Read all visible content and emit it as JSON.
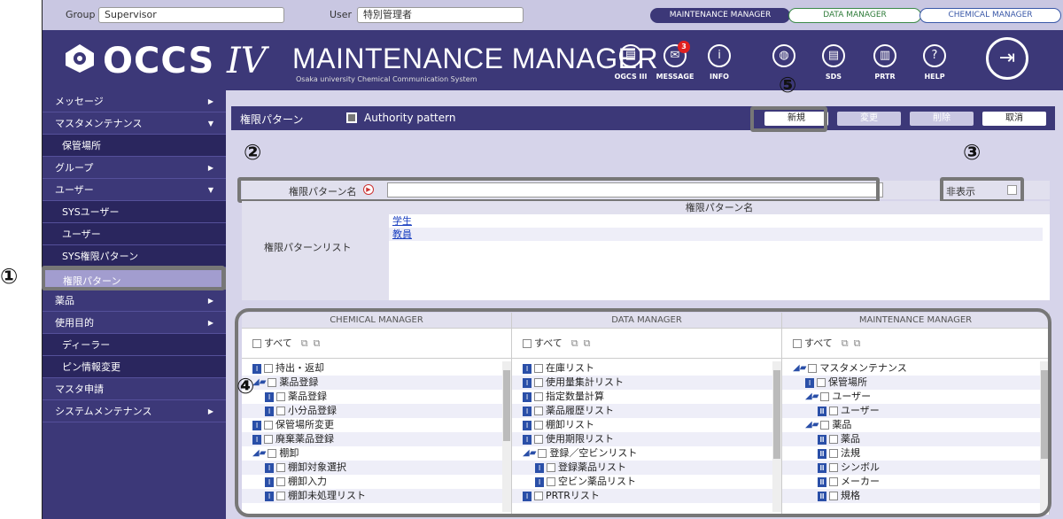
{
  "topbar": {
    "group_label": "Group",
    "group_value": "Supervisor",
    "user_label": "User",
    "user_value": "特別管理者",
    "tabs": [
      "MAINTENANCE MANAGER",
      "DATA MANAGER",
      "CHEMICAL MANAGER"
    ]
  },
  "header": {
    "logo": "OCCS",
    "logo_iv": "IV",
    "title": "MAINTENANCE MANAGER",
    "subtitle": "Osaka university Chemical Communication System",
    "icons": [
      {
        "label": "OGCS III",
        "icon": "book-icon"
      },
      {
        "label": "MESSAGE",
        "icon": "message-icon",
        "badge": "3"
      },
      {
        "label": "INFO",
        "icon": "info-icon"
      },
      {
        "label": "",
        "icon": "globe-icon"
      },
      {
        "label": "SDS",
        "icon": "sds-icon"
      },
      {
        "label": "PRTR",
        "icon": "prtr-icon"
      },
      {
        "label": "HELP",
        "icon": "help-icon"
      }
    ]
  },
  "sidebar": {
    "items": [
      {
        "label": "メッセージ"
      },
      {
        "label": "マスタメンテナンス"
      },
      {
        "label": "保管場所"
      },
      {
        "label": "グループ"
      },
      {
        "label": "ユーザー"
      },
      {
        "label": "SYSユーザー"
      },
      {
        "label": "ユーザー"
      },
      {
        "label": "SYS権限パターン"
      },
      {
        "label": "権限パターン"
      },
      {
        "label": "薬品"
      },
      {
        "label": "使用目的"
      },
      {
        "label": "ディーラー"
      },
      {
        "label": "ピン情報変更"
      },
      {
        "label": "マスタ申請"
      },
      {
        "label": "システムメンテナンス"
      }
    ]
  },
  "main": {
    "title": "権限パターン",
    "title_en": "Authority pattern",
    "buttons": {
      "new": "新規",
      "change": "変更",
      "delete": "削除",
      "cancel": "取消"
    },
    "name_label": "権限パターン名",
    "hidden_label": "非表示",
    "list_label": "権限パターンリスト",
    "list_header": "権限パターン名",
    "list_items": [
      "学生",
      "教員"
    ]
  },
  "annotations": [
    "①",
    "②",
    "③",
    "④",
    "⑤"
  ],
  "permissions": {
    "all_label": "すべて",
    "columns": [
      {
        "header": "CHEMICAL MANAGER",
        "rows": [
          {
            "text": "持出・返却",
            "level": 0,
            "type": "i"
          },
          {
            "text": "薬品登録",
            "level": 0,
            "type": "folder"
          },
          {
            "text": "薬品登録",
            "level": 1,
            "type": "i"
          },
          {
            "text": "小分品登録",
            "level": 1,
            "type": "i"
          },
          {
            "text": "保管場所変更",
            "level": 0,
            "type": "i"
          },
          {
            "text": "廃棄薬品登録",
            "level": 0,
            "type": "i"
          },
          {
            "text": "棚卸",
            "level": 0,
            "type": "folder"
          },
          {
            "text": "棚卸対象選択",
            "level": 1,
            "type": "i"
          },
          {
            "text": "棚卸入力",
            "level": 1,
            "type": "i"
          },
          {
            "text": "棚卸未処理リスト",
            "level": 1,
            "type": "i"
          }
        ]
      },
      {
        "header": "DATA MANAGER",
        "rows": [
          {
            "text": "在庫リスト",
            "level": 0,
            "type": "i"
          },
          {
            "text": "使用量集計リスト",
            "level": 0,
            "type": "i"
          },
          {
            "text": "指定数量計算",
            "level": 0,
            "type": "i"
          },
          {
            "text": "薬品履歴リスト",
            "level": 0,
            "type": "i"
          },
          {
            "text": "棚卸リスト",
            "level": 0,
            "type": "i"
          },
          {
            "text": "使用期限リスト",
            "level": 0,
            "type": "i"
          },
          {
            "text": "登録／空ビンリスト",
            "level": 0,
            "type": "folder"
          },
          {
            "text": "登録薬品リスト",
            "level": 1,
            "type": "i"
          },
          {
            "text": "空ビン薬品リスト",
            "level": 1,
            "type": "i"
          },
          {
            "text": "PRTRリスト",
            "level": 0,
            "type": "i"
          }
        ]
      },
      {
        "header": "MAINTENANCE MANAGER",
        "rows": [
          {
            "text": "マスタメンテナンス",
            "level": 0,
            "type": "folder"
          },
          {
            "text": "保管場所",
            "level": 1,
            "type": "i"
          },
          {
            "text": "ユーザー",
            "level": 1,
            "type": "folder"
          },
          {
            "text": "ユーザー",
            "level": 2,
            "type": "iii"
          },
          {
            "text": "薬品",
            "level": 1,
            "type": "folder"
          },
          {
            "text": "薬品",
            "level": 2,
            "type": "iii"
          },
          {
            "text": "法規",
            "level": 2,
            "type": "iii"
          },
          {
            "text": "シンボル",
            "level": 2,
            "type": "iii"
          },
          {
            "text": "メーカー",
            "level": 2,
            "type": "iii"
          },
          {
            "text": "規格",
            "level": 2,
            "type": "iii"
          }
        ]
      }
    ]
  }
}
